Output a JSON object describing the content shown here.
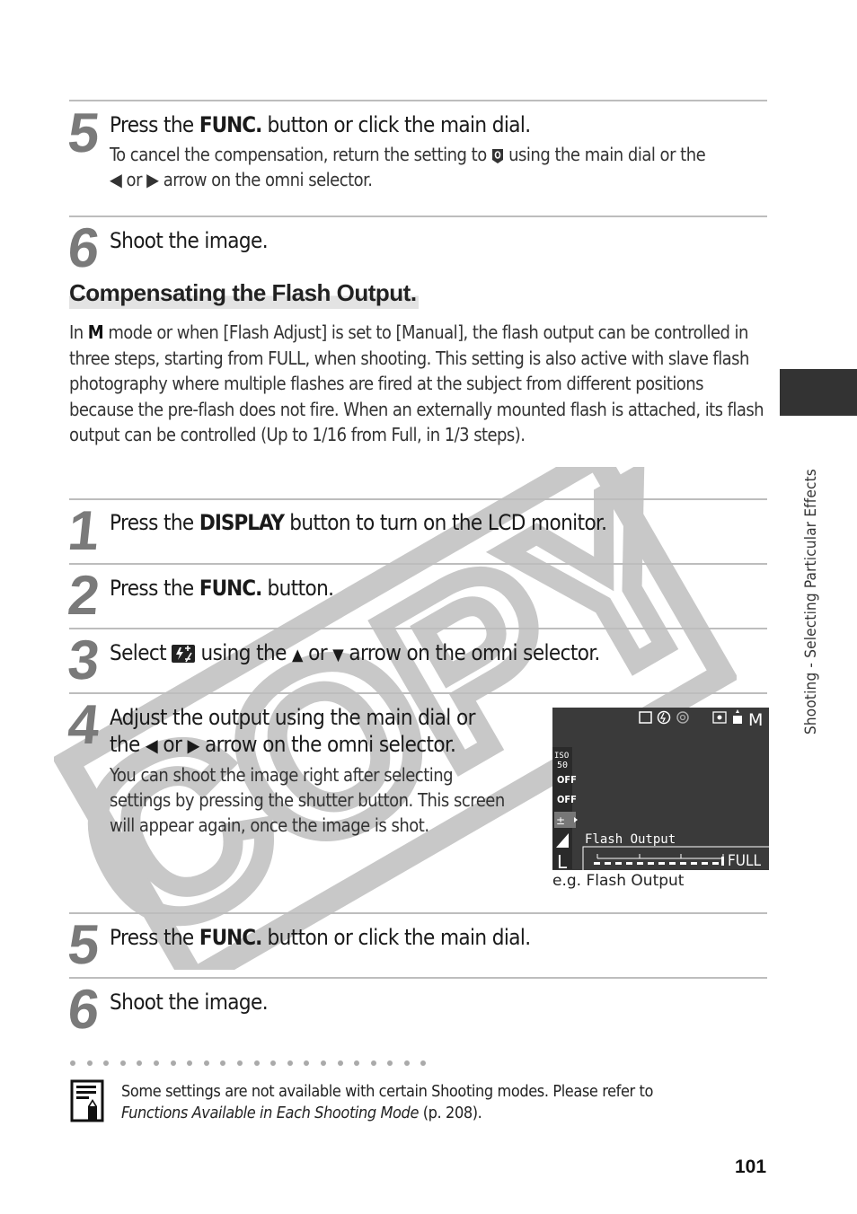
{
  "watermark": {
    "text": "COPY"
  },
  "steps_top": [
    {
      "number": "5",
      "title_pre": "Press the ",
      "title_key": "FUNC.",
      "title_post": " button or click the main dial.",
      "desc_pre": "To cancel the compensation, return the setting to ",
      "desc_icon": "zero-compensation-icon",
      "desc_mid": " using the main dial or the",
      "desc_line2_pre": " or ",
      "desc_line2_post": " arrow on the omni selector."
    },
    {
      "number": "6",
      "title": "Shoot the image."
    }
  ],
  "section": {
    "heading": "Compensating the Flash Output.",
    "para_pre": "In ",
    "para_mode": "M",
    "para_post": " mode or when [Flash Adjust] is set to [Manual], the flash output can be controlled in three steps, starting from FULL, when shooting. This setting is also active with slave flash photography where multiple flashes are fired at the subject from different positions because the pre-flash does not fire. When an externally mounted flash is attached, its flash output can be controlled (Up to 1/16 from Full, in 1/3 steps)."
  },
  "steps": [
    {
      "number": "1",
      "title_pre": "Press the ",
      "title_key": "DISPLAY",
      "title_post": " button to turn on the LCD monitor."
    },
    {
      "number": "2",
      "title_pre": "Press the ",
      "title_key": "FUNC.",
      "title_post": " button."
    },
    {
      "number": "3",
      "title_pre": "Select ",
      "title_mid": " using the ",
      "title_or": " or ",
      "title_post": " arrow on the omni selector."
    },
    {
      "number": "4",
      "title_line1": "Adjust the output using the main dial or",
      "title_line2_pre": "the ",
      "title_line2_or": " or ",
      "title_line2_post": " arrow on the omni selector.",
      "desc": [
        "You can shoot the image right after selecting",
        "settings by pressing the shutter button. This screen",
        "will appear again, once the image is shot."
      ]
    },
    {
      "number": "5",
      "title_pre": "Press the ",
      "title_key": "FUNC.",
      "title_post": " button or click the main dial."
    },
    {
      "number": "6",
      "title": "Shoot the image."
    }
  ],
  "lcd": {
    "top_mode": "M",
    "iso_label": "ISO",
    "iso_value": "50",
    "off1": "OFF",
    "off2": "OFF",
    "menu_label": "Flash Output",
    "scale_end": "FULL",
    "size_letter": "L",
    "caption": "e.g. Flash Output"
  },
  "side_tab": {
    "text": "Shooting - Selecting Particular Effects"
  },
  "note": {
    "line1": "Some settings are not available with certain Shooting modes. Please refer to",
    "ref_italic": "Functions Available in Each Shooting Mode",
    "ref_page": " (p. 208)."
  },
  "page_number": "101"
}
